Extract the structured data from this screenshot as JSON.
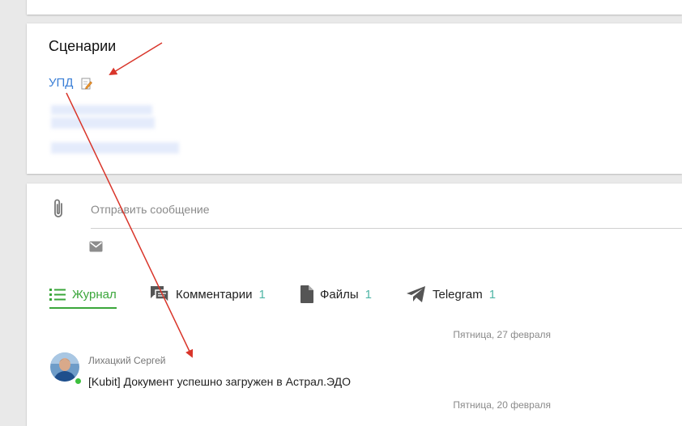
{
  "scenarios": {
    "title": "Сценарии",
    "link": "УПД"
  },
  "composer": {
    "placeholder": "Отправить сообщение"
  },
  "tabs": [
    {
      "label": "Журнал",
      "count": "",
      "active": true
    },
    {
      "label": "Комментарии",
      "count": "1"
    },
    {
      "label": "Файлы",
      "count": "1"
    },
    {
      "label": "Telegram",
      "count": "1"
    }
  ],
  "feed": {
    "date_1": "Пятница, 27 февраля",
    "entry": {
      "author": "Лихацкий Сергей",
      "text": "[Kubit] Документ успешно загружен в Астрал.ЭДО",
      "online": true
    },
    "date_2": "Пятница, 20 февраля"
  },
  "colors": {
    "link": "#3b7fd6",
    "active_tab": "#3aa63a",
    "count": "#4fb5a6",
    "annotation_arrow": "#d9352a"
  }
}
